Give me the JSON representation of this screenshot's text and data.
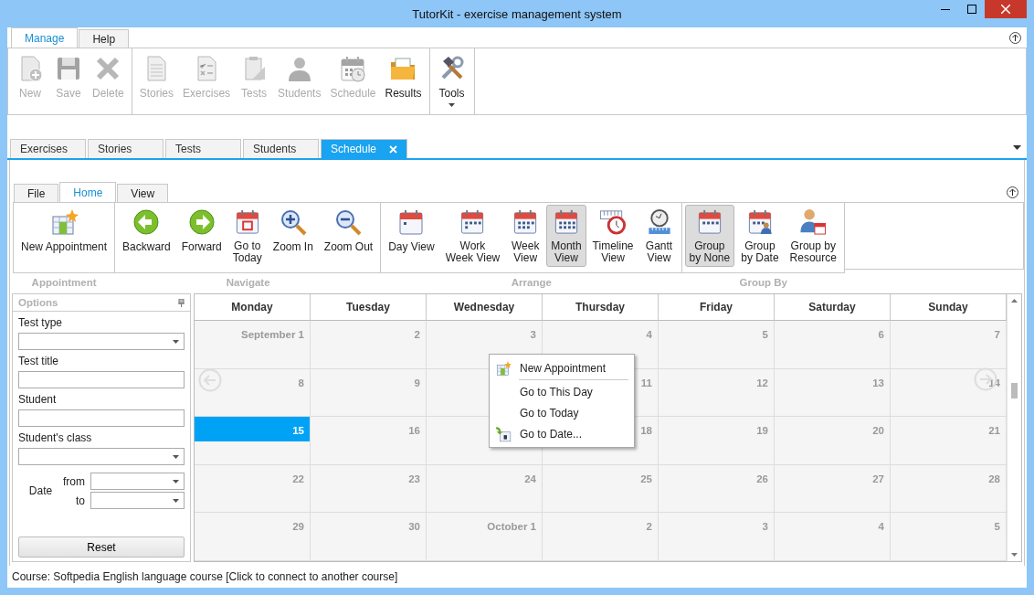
{
  "window": {
    "title": "TutorKit - exercise management system"
  },
  "menu_tabs": [
    {
      "label": "Manage",
      "selected": true
    },
    {
      "label": "Help",
      "selected": false
    }
  ],
  "main_ribbon": [
    {
      "buttons": [
        {
          "label": "New",
          "disabled": true
        },
        {
          "label": "Save",
          "disabled": true
        },
        {
          "label": "Delete",
          "disabled": true
        }
      ]
    },
    {
      "buttons": [
        {
          "label": "Stories",
          "disabled": true
        },
        {
          "label": "Exercises",
          "disabled": true
        },
        {
          "label": "Tests",
          "disabled": true
        },
        {
          "label": "Students",
          "disabled": true
        },
        {
          "label": "Schedule",
          "disabled": true
        },
        {
          "label": "Results",
          "disabled": false
        }
      ]
    },
    {
      "buttons": [
        {
          "label": "Tools",
          "disabled": false,
          "menu": true
        }
      ]
    }
  ],
  "doc_tabs": [
    {
      "label": "Exercises",
      "selected": false
    },
    {
      "label": "Stories",
      "selected": false
    },
    {
      "label": "Tests",
      "selected": false
    },
    {
      "label": "Students",
      "selected": false
    },
    {
      "label": "Schedule",
      "selected": true
    }
  ],
  "inner_tabs": [
    {
      "label": "File",
      "selected": false
    },
    {
      "label": "Home",
      "selected": true
    },
    {
      "label": "View",
      "selected": false
    }
  ],
  "inner_ribbon": [
    {
      "label": "Appointment",
      "buttons": [
        {
          "label": "New Appointment",
          "selected": false
        }
      ]
    },
    {
      "label": "Navigate",
      "buttons": [
        {
          "label": "Backward",
          "selected": false
        },
        {
          "label": "Forward",
          "selected": false
        },
        {
          "label": "Go to\nToday",
          "selected": false
        },
        {
          "label": "Zoom In",
          "selected": false
        },
        {
          "label": "Zoom Out",
          "selected": false
        }
      ]
    },
    {
      "label": "Arrange",
      "buttons": [
        {
          "label": "Day View",
          "selected": false
        },
        {
          "label": "Work\nWeek View",
          "selected": false
        },
        {
          "label": "Week\nView",
          "selected": false
        },
        {
          "label": "Month\nView",
          "selected": true
        },
        {
          "label": "Timeline\nView",
          "selected": false
        },
        {
          "label": "Gantt\nView",
          "selected": false
        }
      ]
    },
    {
      "label": "Group By",
      "buttons": [
        {
          "label": "Group\nby None",
          "selected": true
        },
        {
          "label": "Group\nby Date",
          "selected": false
        },
        {
          "label": "Group by\nResource",
          "selected": false
        }
      ]
    }
  ],
  "options_panel": {
    "title": "Options",
    "fields": [
      {
        "label": "Test type",
        "kind": "dropdown"
      },
      {
        "label": "Test title",
        "kind": "text"
      },
      {
        "label": "Student",
        "kind": "text"
      },
      {
        "label": "Student's class",
        "kind": "dropdown"
      }
    ],
    "date": {
      "label": "Date",
      "from": "from",
      "to": "to"
    },
    "reset": "Reset"
  },
  "calendar": {
    "columns": [
      "Monday",
      "Tuesday",
      "Wednesday",
      "Thursday",
      "Friday",
      "Saturday",
      "Sunday"
    ],
    "weeks": [
      [
        {
          "day": "September 1",
          "selected": false
        },
        {
          "day": "2",
          "selected": false
        },
        {
          "day": "3",
          "selected": false
        },
        {
          "day": "4",
          "selected": false
        },
        {
          "day": "5",
          "selected": false
        },
        {
          "day": "6",
          "selected": false
        },
        {
          "day": "7",
          "selected": false
        }
      ],
      [
        {
          "day": "8",
          "selected": false
        },
        {
          "day": "9",
          "selected": false
        },
        {
          "selected": false
        },
        {
          "day": "11",
          "selected": false
        },
        {
          "day": "12",
          "selected": false
        },
        {
          "day": "13",
          "selected": false
        },
        {
          "day": "14",
          "selected": false
        }
      ],
      [
        {
          "day": "15",
          "selected": true
        },
        {
          "day": "16",
          "selected": false
        },
        {
          "selected": false
        },
        {
          "day": "18",
          "selected": false
        },
        {
          "day": "19",
          "selected": false
        },
        {
          "day": "20",
          "selected": false
        },
        {
          "day": "21",
          "selected": false
        }
      ],
      [
        {
          "day": "22",
          "selected": false
        },
        {
          "day": "23",
          "selected": false
        },
        {
          "day": "24",
          "selected": false
        },
        {
          "day": "25",
          "selected": false
        },
        {
          "day": "26",
          "selected": false
        },
        {
          "day": "27",
          "selected": false
        },
        {
          "day": "28",
          "selected": false
        }
      ],
      [
        {
          "day": "29",
          "selected": false
        },
        {
          "day": "30",
          "selected": false
        },
        {
          "day": "October 1",
          "selected": false
        },
        {
          "day": "2",
          "selected": false
        },
        {
          "day": "3",
          "selected": false
        },
        {
          "day": "4",
          "selected": false
        },
        {
          "day": "5",
          "selected": false
        }
      ]
    ]
  },
  "context_menu": [
    {
      "label": "New Appointment",
      "kind": "new",
      "separator_after": true
    },
    {
      "label": "Go to This Day",
      "kind": "plain"
    },
    {
      "label": "Go to Today",
      "kind": "plain"
    },
    {
      "label": "Go to Date...",
      "kind": "date"
    }
  ],
  "status_bar": "Course: Softpedia English language course [Click to connect to another course]"
}
